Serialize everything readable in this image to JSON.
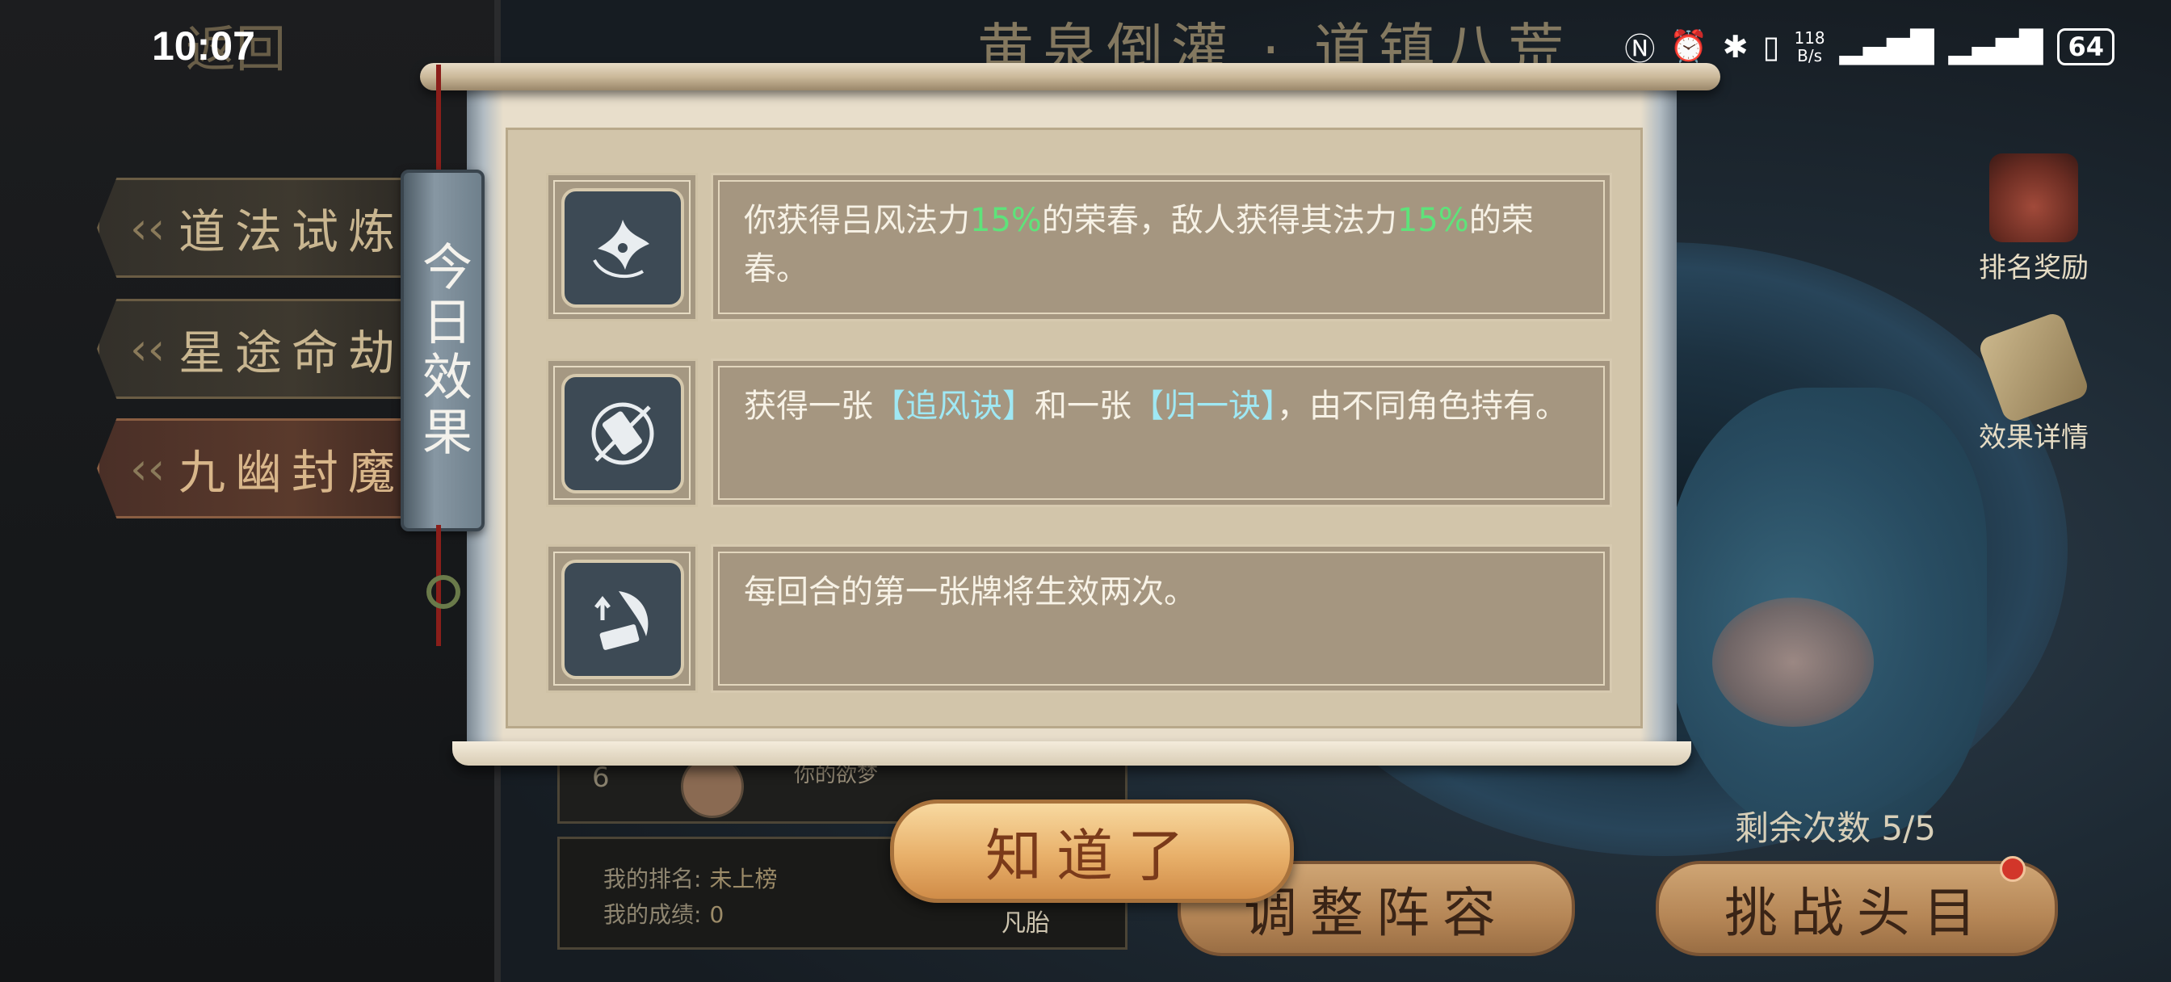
{
  "status_bar": {
    "time": "10:07",
    "network_speed_value": "118",
    "network_speed_unit": "B/s",
    "battery": "64"
  },
  "header": {
    "back_label": "返回",
    "title": "黄泉倒灌 · 道镇八荒"
  },
  "left_menu": {
    "items": [
      {
        "label": "道法试炼"
      },
      {
        "label": "星途命劫"
      },
      {
        "label": "九幽封魔"
      }
    ]
  },
  "leaderboard": {
    "entry": {
      "rank": "6",
      "name": "你的欲梦"
    },
    "my_rank_label": "我的排名:",
    "my_rank_value": "未上榜",
    "my_score_label": "我的成绩:",
    "my_score_value": "0"
  },
  "side_panel": {
    "rank_reward_label": "排名奖励",
    "effect_detail_label": "效果详情",
    "partial_label": "凡胎"
  },
  "remaining": {
    "label": "剩余次数",
    "value": "5/5"
  },
  "bottom_buttons": {
    "adjust_team": "调整阵容",
    "challenge_boss": "挑战头目"
  },
  "modal": {
    "tag_label": "今日效果",
    "effects": [
      {
        "icon": "flower-spirit-icon",
        "parts": [
          "你获得吕风法力",
          "15%",
          "的荣春，敌人获得其法力",
          "15%",
          "的荣春。"
        ]
      },
      {
        "icon": "card-ring-icon",
        "parts": [
          "获得一张",
          "【追风诀】",
          "和一张",
          "【归一诀】",
          "，由不同角色持有。"
        ]
      },
      {
        "icon": "card-swoosh-icon",
        "parts": [
          "每回合的第一张牌将生效两次。"
        ]
      }
    ],
    "ok_label": "知道了"
  },
  "colors": {
    "highlight_green": "#5ee37a",
    "highlight_blue": "#9fe8f4",
    "notification_dot": "#d2362a"
  }
}
